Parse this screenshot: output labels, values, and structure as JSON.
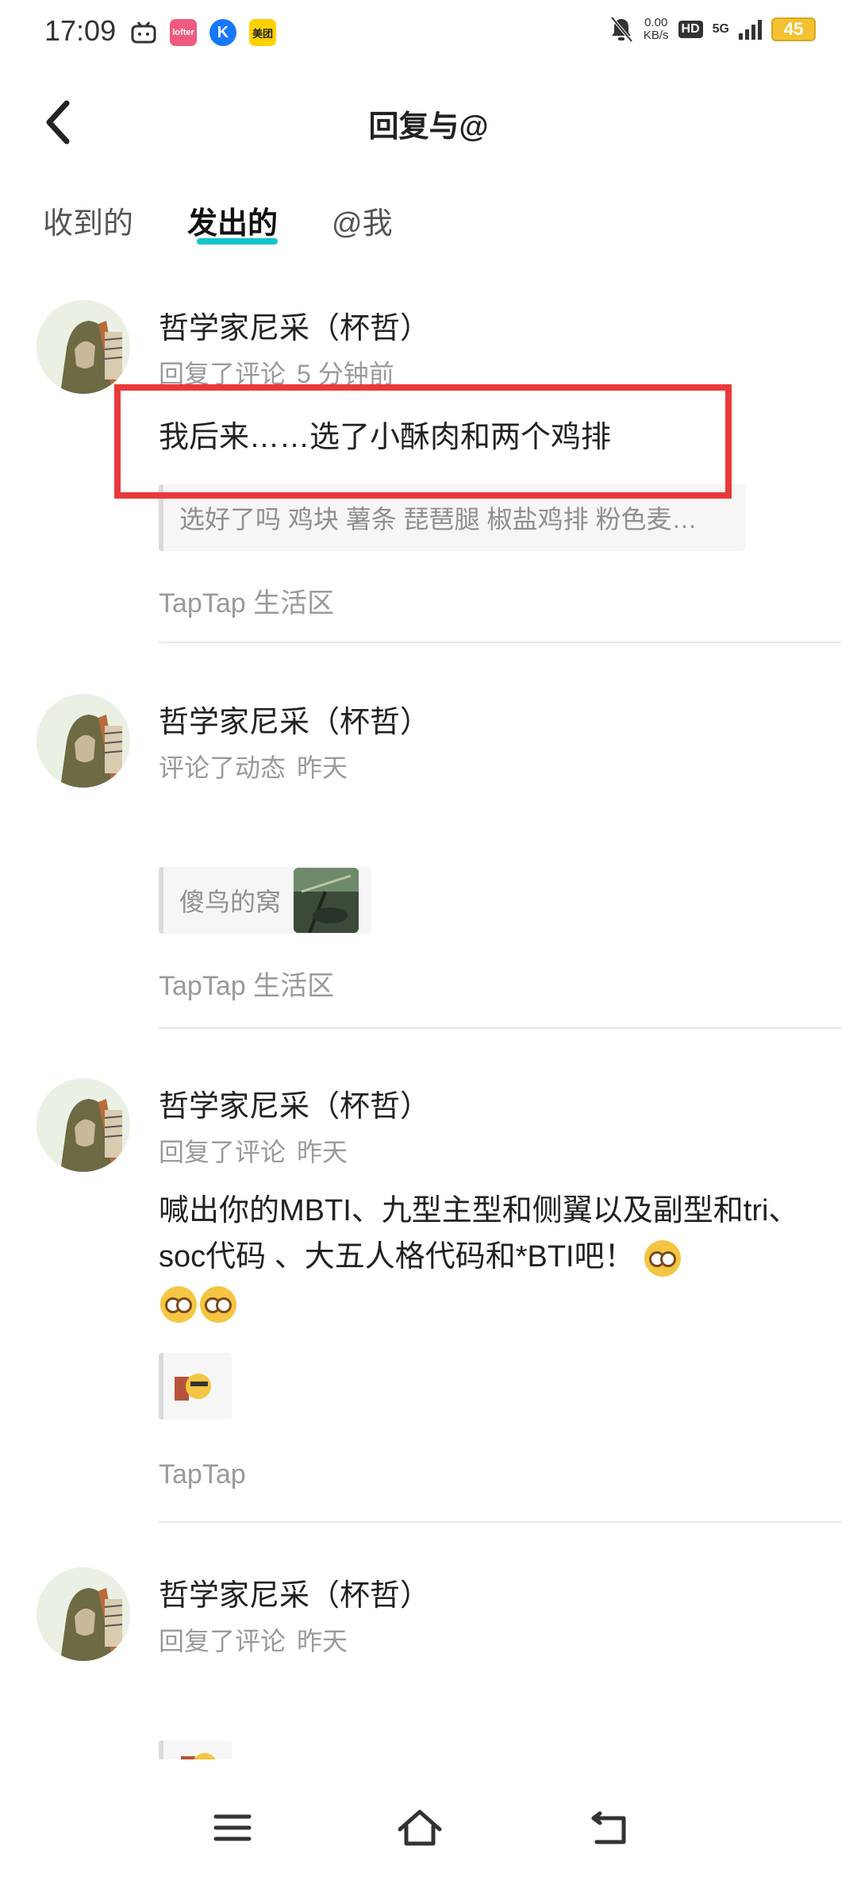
{
  "status_bar": {
    "time": "17:09",
    "app_icons": [
      {
        "name": "bilibili-icon",
        "text": ""
      },
      {
        "name": "lofter-icon",
        "text": "lofter"
      },
      {
        "name": "kugou-icon",
        "text": "K"
      },
      {
        "name": "meituan-icon",
        "text": "美团"
      }
    ],
    "net_speed": "0.00",
    "net_unit": "KB/s",
    "hd": "HD",
    "network": "5G",
    "battery": "45"
  },
  "header": {
    "title": "回复与@"
  },
  "tabs": [
    {
      "label": "收到的",
      "active": false
    },
    {
      "label": "发出的",
      "active": true
    },
    {
      "label": "@我",
      "active": false
    }
  ],
  "items": [
    {
      "username": "哲学家尼采（杯哲）",
      "action": "回复了评论",
      "time": "5 分钟前",
      "text": "我后来……选了小酥肉和两个鸡排",
      "quote": "选好了吗 鸡块 薯条 琵琶腿 椒盐鸡排 粉色麦…",
      "source": "TapTap 生活区"
    },
    {
      "username": "哲学家尼采（杯哲）",
      "action": "评论了动态",
      "time": "昨天",
      "quote": "傻鸟的窝",
      "source": "TapTap 生活区"
    },
    {
      "username": "哲学家尼采（杯哲）",
      "action": "回复了评论",
      "time": "昨天",
      "text": "喊出你的MBTI、九型主型和侧翼以及副型和tri、soc代码 、大五人格代码和*BTI吧！",
      "source": "TapTap"
    },
    {
      "username": "哲学家尼采（杯哲）",
      "action": "回复了评论",
      "time": "昨天"
    }
  ],
  "colors": {
    "accent": "#15c5ce",
    "highlight": "#e9393b",
    "meta": "#9a9a9a"
  }
}
